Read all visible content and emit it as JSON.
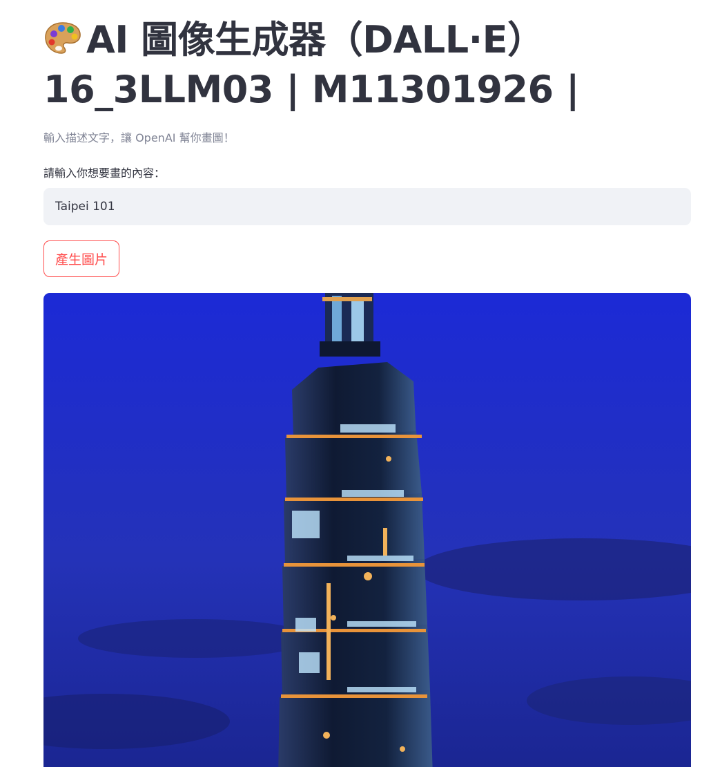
{
  "header": {
    "title_line1": "AI 圖像生成器（DALL·E）",
    "title_line2": "16_3LLM03 | M11301926 |",
    "title_icon": "artist-palette-icon",
    "subtitle": "輸入描述文字，讓 OpenAI 幫你畫圖！"
  },
  "prompt": {
    "label": "請輸入你想要畫的內容：",
    "value": "Taipei 101"
  },
  "actions": {
    "generate_label": "產生圖片"
  },
  "result": {
    "image_subject": "Taipei 101 tower at dusk"
  },
  "colors": {
    "accent": "#ff4b4b",
    "text": "#31333f",
    "muted": "#808495",
    "input_bg": "#f0f2f6",
    "sky": "#1f2fc4"
  }
}
